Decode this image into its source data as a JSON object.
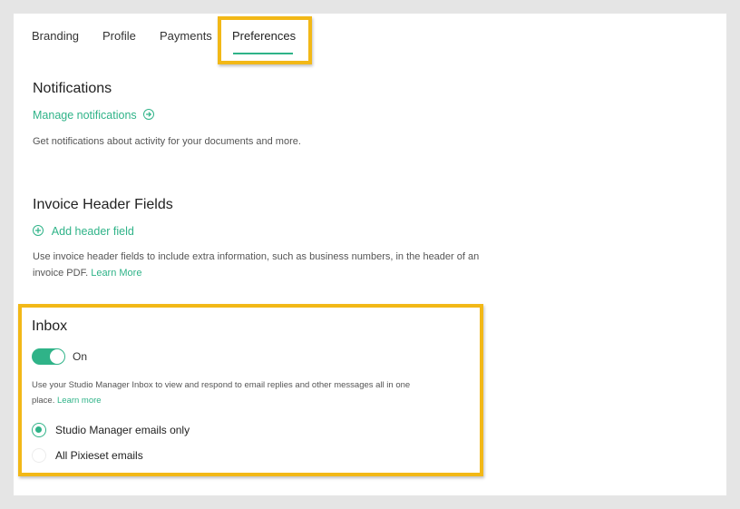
{
  "tabs": [
    {
      "label": "Branding"
    },
    {
      "label": "Profile"
    },
    {
      "label": "Payments"
    },
    {
      "label": "Preferences",
      "active": true
    }
  ],
  "notifications": {
    "title": "Notifications",
    "link": "Manage notifications",
    "description": "Get notifications about activity for your documents and more."
  },
  "invoice_header": {
    "title": "Invoice Header Fields",
    "link": "Add header field",
    "description_line1": "Use invoice header fields to include extra information, such as business numbers, in the header of an",
    "description_line2": "invoice PDF.",
    "learn_more": "Learn More"
  },
  "inbox": {
    "title": "Inbox",
    "toggle_label": "On",
    "toggle_on": true,
    "description_line1": "Use your Studio Manager Inbox to view and respond to email replies and other messages all in one",
    "description_line2": "place.",
    "learn_more": "Learn more",
    "options": [
      {
        "label": "Studio Manager emails only",
        "selected": true
      },
      {
        "label": "All Pixieset emails",
        "selected": false
      }
    ]
  },
  "colors": {
    "accent": "#2fb388",
    "highlight": "#f2b817"
  }
}
